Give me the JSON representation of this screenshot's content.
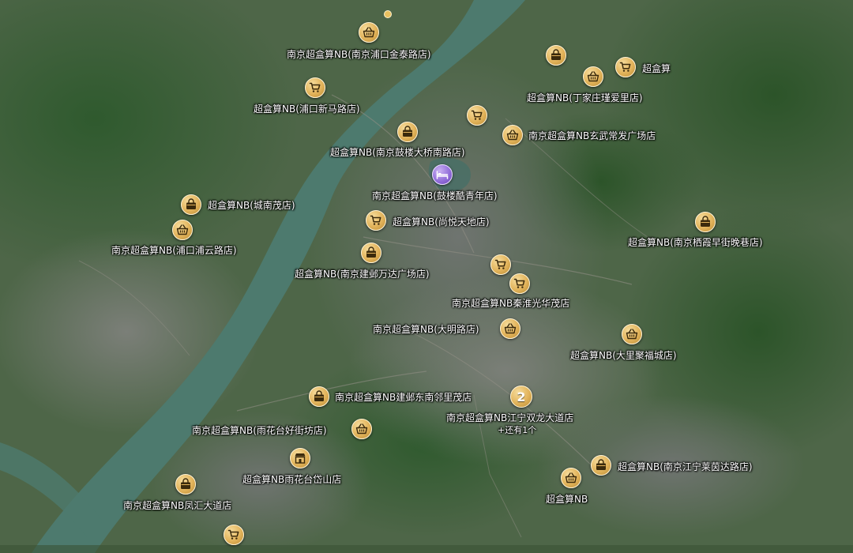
{
  "map": {
    "cluster": {
      "count": "2",
      "label": "南京超盒算NB江宁双龙大道店",
      "more": "+还有1个"
    },
    "pois": [
      {
        "name": "南京超盒算NB(南京浦口金泰路店)",
        "icon": "cart-basket-icon"
      },
      {
        "name": "超盒算NB(浦口新马路店)",
        "icon": "cart-icon"
      },
      {
        "name": "超盒算NB(南京鼓楼大桥南路店)",
        "icon": "store-bag-icon"
      },
      {
        "name": "南京超盒算NB(鼓楼酷青年店)",
        "icon": "hotel-bed-icon"
      },
      {
        "name": "超盒算NB(城南茂店)",
        "icon": "store-bag-icon"
      },
      {
        "name": "南京超盒算NB(浦口浦云路店)",
        "icon": "cart-basket-icon"
      },
      {
        "name": "超盒算NB(尚悦天地店)",
        "icon": "cart-icon"
      },
      {
        "name": "超盒算NB(南京建邺万达广场店)",
        "icon": "store-bag-icon"
      },
      {
        "name": "超盒算",
        "icon": "cart-icon"
      },
      {
        "name": "超盒算NB(丁家庄瑾爱里店)",
        "icon": "cart-basket-icon"
      },
      {
        "name": "南京超盒算NB玄武常发广场店",
        "icon": "cart-basket-icon"
      },
      {
        "name": "超盒算NB(南京栖霞早街晚巷店)",
        "icon": "store-bag-icon"
      },
      {
        "name": "南京超盒算NB秦淮光华茂店",
        "icon": "cart-icon"
      },
      {
        "name": "南京超盒算NB(大明路店)",
        "icon": "cart-basket-icon"
      },
      {
        "name": "超盒算NB(大里聚福城店)",
        "icon": "cart-basket-icon"
      },
      {
        "name": "南京超盒算NB建邺东南邻里茂店",
        "icon": "store-bag-icon"
      },
      {
        "name": "南京超盒算NB(雨花台好街坊店)",
        "icon": "cart-basket-icon"
      },
      {
        "name": "超盒算NB雨花台岱山店",
        "icon": "storefront-icon"
      },
      {
        "name": "南京超盒算NB凤汇大道店",
        "icon": "store-bag-icon"
      },
      {
        "name": "超盒算NB(南京江宁莱茵达路店)",
        "icon": "store-bag-icon"
      },
      {
        "name": "超盒算NB",
        "icon": "cart-basket-icon"
      }
    ],
    "unlabeled_markers": [
      {
        "icon": "store-bag-icon"
      },
      {
        "icon": "cart-icon"
      },
      {
        "icon": "cart-icon"
      },
      {
        "icon": "cart-icon"
      }
    ],
    "colors": {
      "marker_gold": "#e2b35a",
      "marker_hotel": "#8f6ad8",
      "river": "#4d7a6e",
      "label_text": "#ffffff"
    }
  }
}
